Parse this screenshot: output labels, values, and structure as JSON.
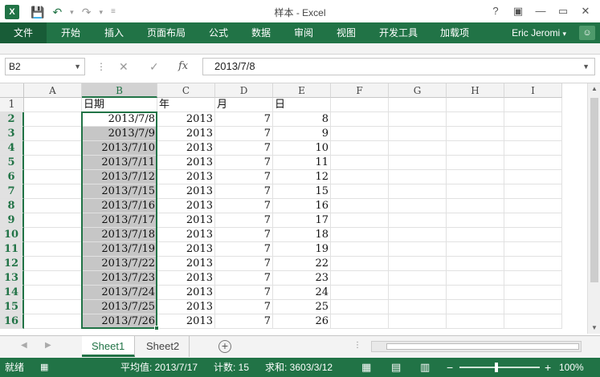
{
  "window": {
    "title": "样本 - Excel",
    "logo": "X",
    "controls": [
      "?",
      "▣",
      "—",
      "▭",
      "✕"
    ]
  },
  "ribbon": {
    "tabs": [
      "文件",
      "开始",
      "插入",
      "页面布局",
      "公式",
      "数据",
      "审阅",
      "视图",
      "开发工具",
      "加载项"
    ],
    "user": "Eric Jeromi",
    "user_caret": "▾"
  },
  "formula_bar": {
    "name_box": "B2",
    "cancel_icon": "✕",
    "enter_icon": "✓",
    "fx_label": "fx",
    "value": "2013/7/8"
  },
  "grid": {
    "columns": [
      "A",
      "B",
      "C",
      "D",
      "E",
      "F",
      "G",
      "H",
      "I"
    ],
    "rows": [
      "1",
      "2",
      "3",
      "4",
      "5",
      "6",
      "7",
      "8",
      "9",
      "10",
      "11",
      "12",
      "13",
      "14",
      "15",
      "16"
    ],
    "header_row": [
      "",
      "日期",
      "年",
      "月",
      "日"
    ],
    "data": [
      [
        "2013/7/8",
        "2013",
        "7",
        "8"
      ],
      [
        "2013/7/9",
        "2013",
        "7",
        "9"
      ],
      [
        "2013/7/10",
        "2013",
        "7",
        "10"
      ],
      [
        "2013/7/11",
        "2013",
        "7",
        "11"
      ],
      [
        "2013/7/12",
        "2013",
        "7",
        "12"
      ],
      [
        "2013/7/15",
        "2013",
        "7",
        "15"
      ],
      [
        "2013/7/16",
        "2013",
        "7",
        "16"
      ],
      [
        "2013/7/17",
        "2013",
        "7",
        "17"
      ],
      [
        "2013/7/18",
        "2013",
        "7",
        "18"
      ],
      [
        "2013/7/19",
        "2013",
        "7",
        "19"
      ],
      [
        "2013/7/22",
        "2013",
        "7",
        "22"
      ],
      [
        "2013/7/23",
        "2013",
        "7",
        "23"
      ],
      [
        "2013/7/24",
        "2013",
        "7",
        "24"
      ],
      [
        "2013/7/25",
        "2013",
        "7",
        "25"
      ],
      [
        "2013/7/26",
        "2013",
        "7",
        "26"
      ]
    ]
  },
  "sheets": {
    "tabs": [
      "Sheet1",
      "Sheet2"
    ],
    "active": "Sheet1",
    "add_label": "+"
  },
  "status_bar": {
    "mode": "就绪",
    "average": "平均值: 2013/7/17",
    "count": "计数: 15",
    "sum": "求和: 3603/3/12",
    "zoom": "100%",
    "zoom_minus": "−",
    "zoom_plus": "+"
  },
  "colors": {
    "accent": "#217346",
    "selection_fill": "#c6c6c6"
  }
}
